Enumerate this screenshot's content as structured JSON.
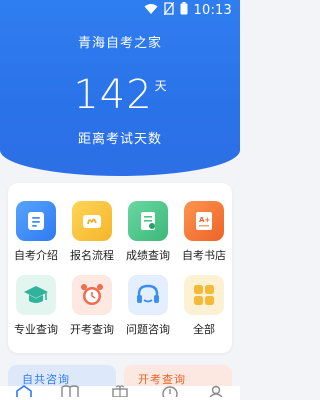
{
  "status_bar": {
    "time": "10:13"
  },
  "header": {
    "title": "青海自考之家"
  },
  "countdown": {
    "days": "142",
    "unit": "天",
    "label": "距离考试天数"
  },
  "menu": {
    "items": [
      {
        "label": "自考介绍",
        "icon": "document-icon",
        "color": "#3d8ef6"
      },
      {
        "label": "报名流程",
        "icon": "signup-icon",
        "color": "#f7c335"
      },
      {
        "label": "成绩查询",
        "icon": "score-icon",
        "color": "#4fc38a"
      },
      {
        "label": "自考书店",
        "icon": "book-grade-icon",
        "color": "#f47a3a"
      },
      {
        "label": "专业查询",
        "icon": "graduation-cap-icon",
        "color": "#2fb39a"
      },
      {
        "label": "开考查询",
        "icon": "alarm-clock-icon",
        "color": "#f26b4d"
      },
      {
        "label": "问题咨询",
        "icon": "headset-icon",
        "color": "#3a8ef0"
      },
      {
        "label": "全部",
        "icon": "grid-icon",
        "color": "#f6b936"
      }
    ]
  },
  "peek_cards": {
    "left_text": "自共咨询",
    "right_text": "开考查询"
  }
}
